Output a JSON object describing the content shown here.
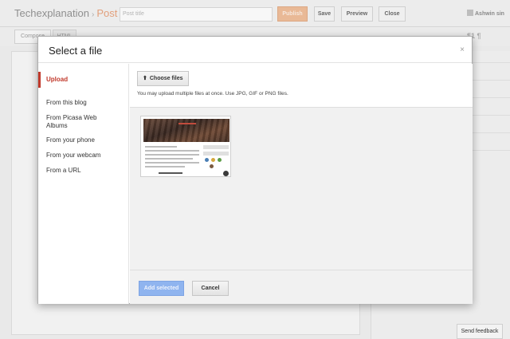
{
  "app": {
    "blog_name": "Techexplanation",
    "separator": "›",
    "section": "Post",
    "post_title_placeholder": "Post title",
    "user_name": "Ashwin sin"
  },
  "top_buttons": {
    "publish": "Publish",
    "save": "Save",
    "preview": "Preview",
    "close": "Close"
  },
  "toolbar": {
    "compose_tab": "Compose",
    "html_tab": "HTML",
    "right_glyphs": "¶1 ¶"
  },
  "dialog": {
    "title": "Select a file",
    "close_glyph": "×",
    "nav": [
      "Upload",
      "From this blog",
      "From Picasa Web Albums",
      "From your phone",
      "From your webcam",
      "From a URL"
    ],
    "active_index": 0,
    "choose_files_label": "Choose files",
    "upload_hint": "You may upload multiple files at once. Use JPG, GIF or PNG files.",
    "add_selected_label": "Add selected",
    "cancel_label": "Cancel"
  },
  "feedback_label": "Send feedback",
  "colors": {
    "accent_red": "#c1392b",
    "primary_blue": "#8fb4ef",
    "publish_orange": "#e9b996"
  }
}
